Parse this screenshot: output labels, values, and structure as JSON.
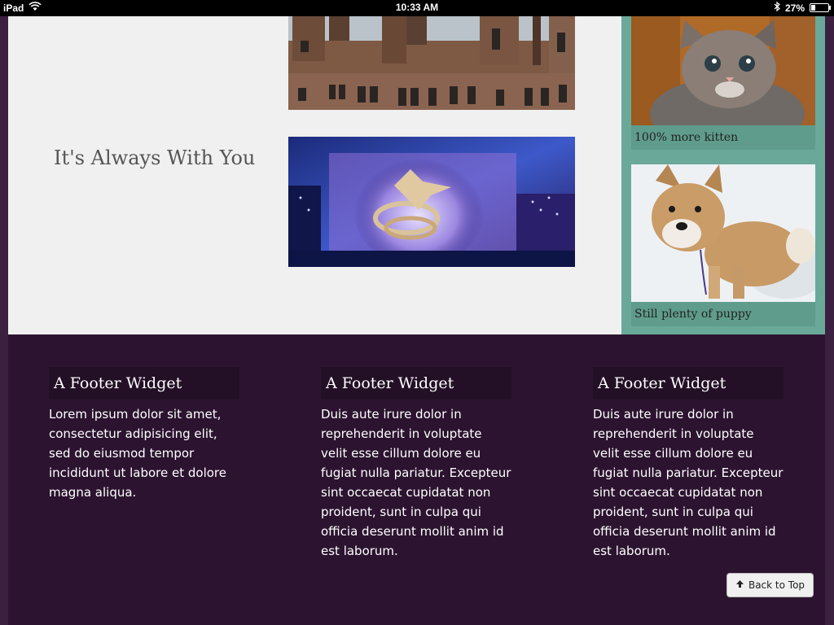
{
  "status_bar": {
    "device": "iPad",
    "time": "10:33 AM",
    "battery": "27%",
    "battery_level": 0.27,
    "icons": [
      "wifi-icon",
      "bluetooth-icon",
      "battery-icon"
    ]
  },
  "content": {
    "caption": "It's Always With You",
    "images": [
      "brick-building-photo",
      "ice-skating-statue-photo"
    ]
  },
  "sidebar": {
    "cards": [
      {
        "label": "100% more kitten",
        "image": "kitten-photo"
      },
      {
        "label": "Still plenty of puppy",
        "image": "puppy-photo"
      }
    ]
  },
  "footer": {
    "widgets": [
      {
        "title": "A Footer Widget",
        "text": "Lorem ipsum dolor sit amet, consectetur adipisicing elit, sed do eiusmod tempor incididunt ut labore et dolore magna aliqua."
      },
      {
        "title": "A Footer Widget",
        "text": "Duis aute irure dolor in reprehenderit in voluptate velit esse cillum dolore eu fugiat nulla pariatur. Excepteur sint occaecat cupidatat non proident, sunt in culpa qui officia deserunt mollit anim id est laborum."
      },
      {
        "title": "A Footer Widget",
        "text": "Duis aute irure dolor in reprehenderit in voluptate velit esse cillum dolore eu fugiat nulla pariatur. Excepteur sint occaecat cupidatat non proident, sunt in culpa qui officia deserunt mollit anim id est laborum."
      }
    ],
    "back_to_top": "Back to Top"
  },
  "colors": {
    "page_bg": "#3b2040",
    "content_bg": "#f0f0f0",
    "sidebar_bg": "#6aa99a",
    "footer_bg": "#2c1430"
  }
}
